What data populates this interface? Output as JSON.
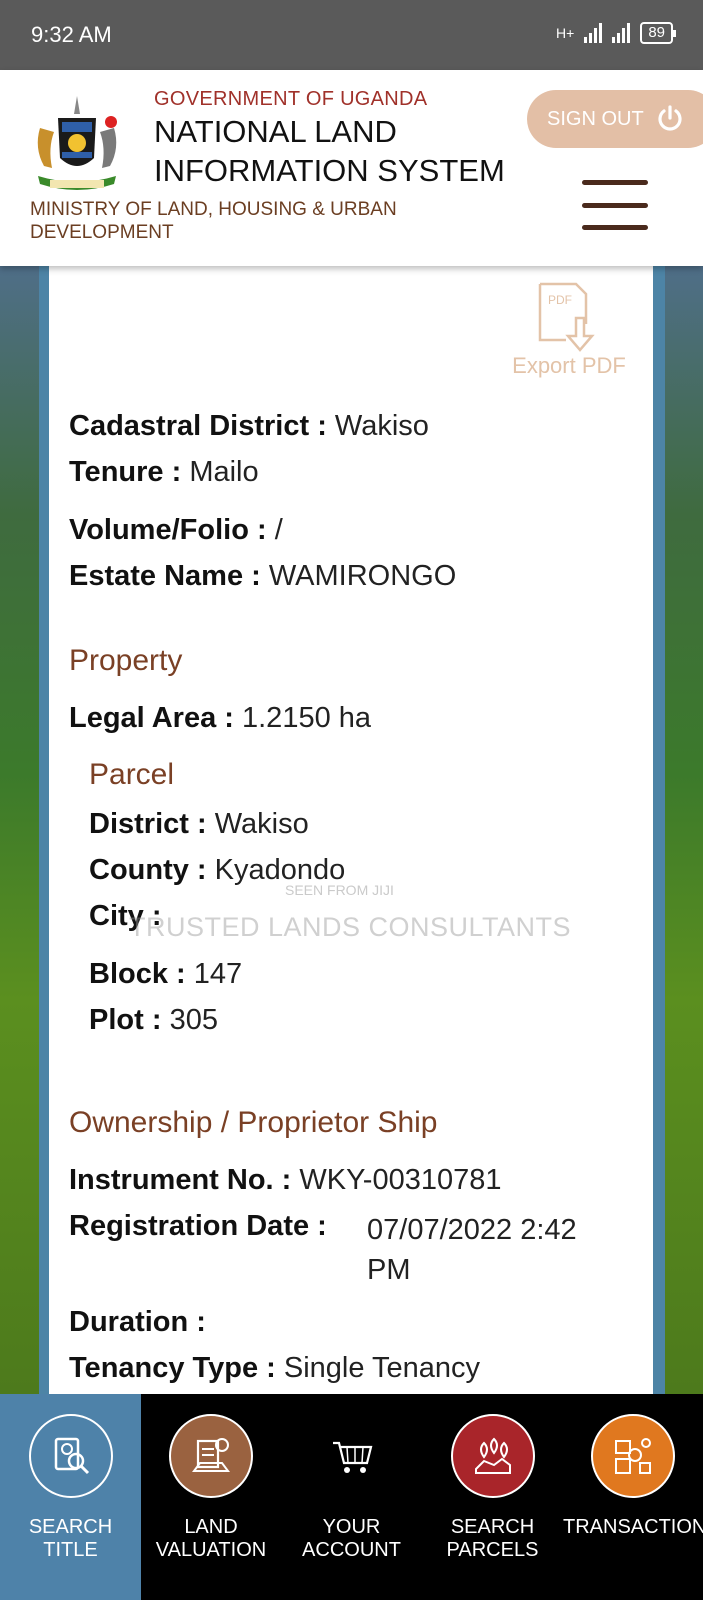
{
  "status_bar": {
    "time": "9:32 AM",
    "network": "H+",
    "battery": "89"
  },
  "header": {
    "government": "GOVERNMENT OF UGANDA",
    "system_line1": "NATIONAL LAND",
    "system_line2": "INFORMATION SYSTEM",
    "ministry_line1": "MINISTRY OF LAND, HOUSING & URBAN",
    "ministry_line2": "DEVELOPMENT",
    "sign_out": "SIGN OUT"
  },
  "export": {
    "label": "Export PDF",
    "icon_text": "PDF"
  },
  "details": {
    "cadastral_district_label": "Cadastral District :",
    "cadastral_district": "Wakiso",
    "tenure_label": "Tenure :",
    "tenure": "Mailo",
    "volume_folio_label": "Volume/Folio :",
    "volume_folio": "/",
    "estate_name_label": "Estate Name :",
    "estate_name": "WAMIRONGO"
  },
  "property": {
    "heading": "Property",
    "legal_area_label": "Legal Area :",
    "legal_area": "1.2150 ha",
    "parcel_heading": "Parcel",
    "district_label": "District :",
    "district": "Wakiso",
    "county_label": "County :",
    "county": "Kyadondo",
    "city_label": "City :",
    "city": "",
    "block_label": "Block :",
    "block": "147",
    "plot_label": "Plot :",
    "plot": "305"
  },
  "ownership": {
    "heading": "Ownership / Proprietor Ship",
    "instrument_label": "Instrument No. :",
    "instrument": "WKY-00310781",
    "registration_label": "Registration Date :",
    "registration_line1": "07/07/2022 2:42",
    "registration_line2": "PM",
    "duration_label": "Duration :",
    "duration": "",
    "tenancy_label": "Tenancy Type :",
    "tenancy": "Single Tenancy"
  },
  "watermark": {
    "main": "TRUSTED LANDS CONSULTANTS",
    "small": "SEEN FROM JIJI"
  },
  "bottom_nav": [
    {
      "line1": "SEARCH",
      "line2": "TITLE",
      "icon": "search-title-icon"
    },
    {
      "line1": "LAND",
      "line2": "VALUATION",
      "icon": "land-valuation-icon"
    },
    {
      "line1": "YOUR",
      "line2": "ACCOUNT",
      "icon": "cart-icon"
    },
    {
      "line1": "SEARCH",
      "line2": "PARCELS",
      "icon": "map-pins-icon"
    },
    {
      "line1": "TRANSACTIONS",
      "line2": "",
      "icon": "transactions-icon"
    }
  ],
  "colors": {
    "accent_brown": "#7a4025",
    "gov_red": "#a0312a",
    "signout_bg": "#e3bfa6",
    "nav_active": "#4e82a9",
    "valuation_circle": "#9a6240",
    "parcels_circle": "#a9252a",
    "transactions_circle": "#e0781f"
  }
}
